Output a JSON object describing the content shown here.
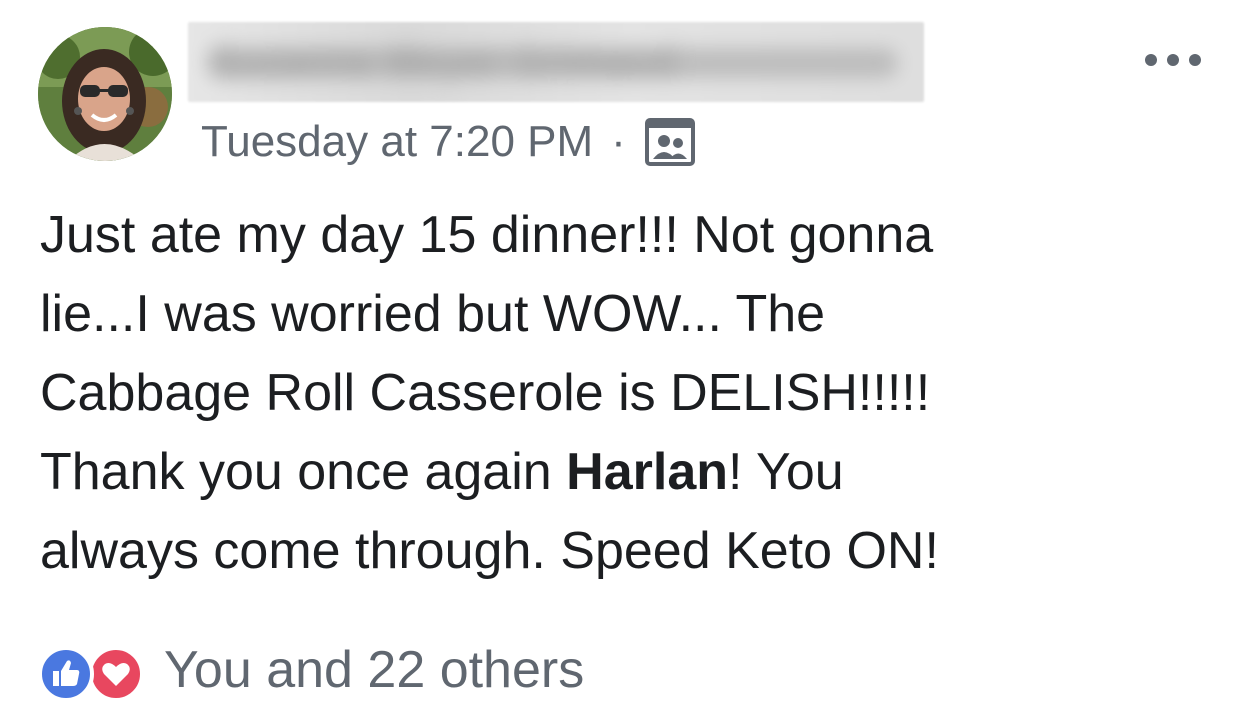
{
  "post": {
    "author": {
      "name": "Suzanne Meyer Grimaud",
      "name_blurred": true
    },
    "timestamp": "Tuesday at 7:20 PM",
    "separator": "·",
    "audience_icon": "group-audience-icon",
    "more_icon": "more-options-icon",
    "message": {
      "line1": "Just ate my day 15 dinner!!!  Not gonna",
      "line2": "lie...I was worried but WOW... The",
      "line3": "Cabbage Roll Casserole is DELISH!!!!!",
      "line4_before": "Thank you once again ",
      "mention": "Harlan",
      "line4_after": "!  You",
      "line5": "always come through.  Speed Keto ON!"
    },
    "reactions": {
      "icons": [
        "like-icon",
        "love-icon"
      ],
      "summary": "You and 22 others"
    }
  },
  "colors": {
    "text_primary": "#1c1e21",
    "text_secondary": "#606770",
    "like_blue": "#4a78e0",
    "love_red": "#e8475f"
  }
}
